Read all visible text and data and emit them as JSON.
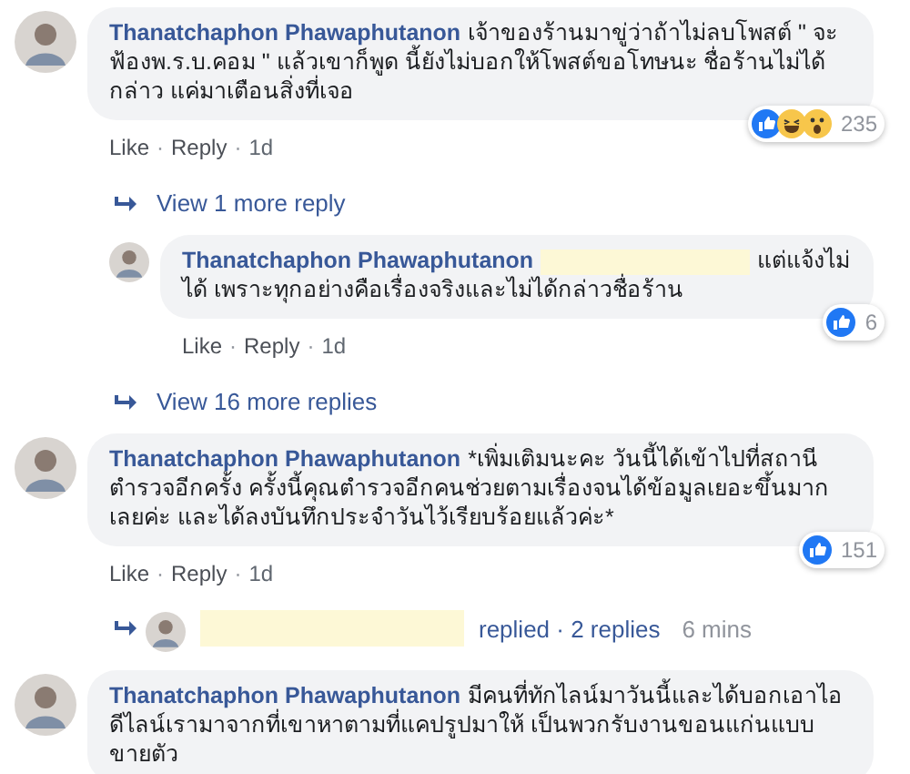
{
  "comments": [
    {
      "kind": "comment",
      "author": "Thanatchaphon Phawaphutanon",
      "text": "เจ้าของร้านมาขู่ว่าถ้าไม่ลบโพสต์ \" จะฟ้องพ.ร.บ.คอม \" แล้วเขาก็พูด นี้ยังไม่บอกให้โพสต์ขอโทษนะ ชื่อร้านไม่ได้กล่าว แค่มาเตือนสิ่งที่เจอ",
      "actions": [
        "Like",
        "·",
        "Reply",
        "·",
        "1d"
      ],
      "reactions": [
        {
          "kind": "like"
        },
        {
          "kind": "haha"
        },
        {
          "kind": "wow"
        }
      ],
      "reaction_count": "235",
      "children": [
        {
          "kind": "view_more",
          "text": "View 1 more reply"
        },
        {
          "kind": "comment",
          "author": "Thanatchaphon Phawaphutanon",
          "redacted": true,
          "text": "แต่แจ้งไม่ได้ เพราะทุกอย่างคือเรื่องจริงและไม่ได้กล่าวชื่อร้าน",
          "actions": [
            "Like",
            "·",
            "Reply",
            "·",
            "1d"
          ],
          "reactions": [
            {
              "kind": "like"
            }
          ],
          "reaction_count": "6"
        },
        {
          "kind": "view_more",
          "text": "View 16 more replies"
        }
      ]
    },
    {
      "kind": "comment",
      "author": "Thanatchaphon Phawaphutanon",
      "text": "*เพิ่มเติมนะคะ วันนี้ได้เข้าไปที่สถานีตำรวจอีกครั้ง ครั้งนี้คุณตำรวจอีกคนช่วยตามเรื่องจนได้ข้อมูลเยอะขึ้นมากเลยค่ะ และได้ลงบันทึกประจำวันไว้เรียบร้อยแล้วค่ะ*",
      "actions": [
        "Like",
        "·",
        "Reply",
        "·",
        "1d"
      ],
      "reactions": [
        {
          "kind": "like"
        }
      ],
      "reaction_count": "151",
      "children": [
        {
          "kind": "replied_summary",
          "redacted": true,
          "text": "replied · 2 replies",
          "time": "6 mins"
        }
      ]
    },
    {
      "kind": "comment",
      "author": "Thanatchaphon Phawaphutanon",
      "text": "มีคนที่ทักไลน์มาวันนี้และได้บอกเอาไอดีไลน์เรามาจากที่เขาหาตามที่แคปรูปมาให้ เป็นพวกรับงานขอนแก่นแบบขายตัว"
    }
  ]
}
